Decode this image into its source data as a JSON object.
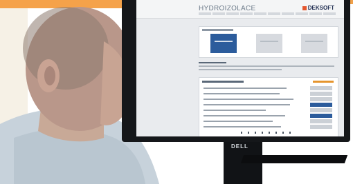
{
  "screen": {
    "title": "HYDROIZOLACE",
    "logo": "DEKSOFT"
  },
  "monitor": {
    "brand": "DELL"
  },
  "colors": {
    "accent_blue": "#2c5c9c",
    "brand_orange": "#e5952e",
    "top_bar": "#f5a24a"
  },
  "icons": {
    "logo_mark": "deksoft-logo-icon"
  }
}
